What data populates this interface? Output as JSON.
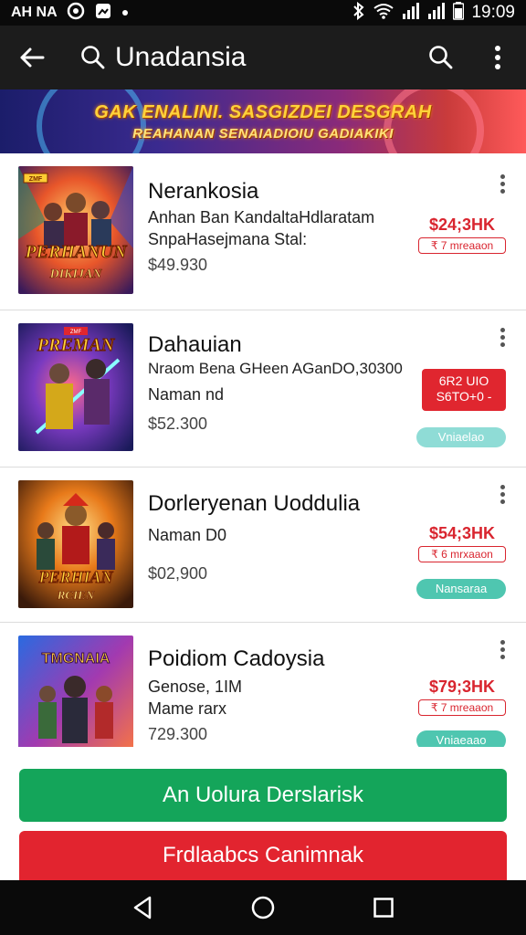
{
  "status_bar": {
    "carrier": "AH NA",
    "time": "19:09"
  },
  "app_bar": {
    "title": "Unadansia"
  },
  "banner": {
    "line1": "GAK ENALINI. SASGIZDEI DESGRAH",
    "line2": "REAHANAN SENAIADIOIU GADIAKIKI"
  },
  "items": [
    {
      "title": "Nerankosia",
      "line1": "Anhan Ban KandaltaHdlaratam",
      "line2": "SnpaHasejmana Stal:",
      "price": "$49.930",
      "side_price": "$24;3HK",
      "side_tag": "₹ 7 mreaaon",
      "thumb_text1": "PERHANUN",
      "thumb_text2": "DIKIJAN",
      "thumb_badge": "ZMF"
    },
    {
      "title": "Dahauian",
      "line1": "Nraom Bena GHeen AGanDO,30300",
      "line2": "Naman nd",
      "price": "$52.300",
      "side_button_line1": "6R2 UIO",
      "side_button_line2": "S6TO+0 -",
      "pill": "Vniaelao",
      "thumb_text1": "PREMAN",
      "thumb_badge": "ZMF"
    },
    {
      "title": "Dorleryenan Uoddulia",
      "line1": "Naman D0",
      "price": "$02,900",
      "side_price": "$54;3HK",
      "side_tag": "₹ 6 mrxaaon",
      "pill": "Nansaraa",
      "thumb_text1": "PERHIAN",
      "thumb_text2": "RCIEN"
    },
    {
      "title": "Poidiom Cadoysia",
      "line1": "Genose, 1IM",
      "line2": "Mame rarx",
      "price": "729.300",
      "side_price": "$79;3HK",
      "side_tag": "₹ 7 mreaaon",
      "pill": "Vniaeaao",
      "thumb_text1": "TMGNAIA"
    }
  ],
  "buttons": {
    "green": "An Uolura Derslarisk",
    "red": "Frdlaabcs Canimnak"
  },
  "colors": {
    "app_bar": "#1c1c1c",
    "accent_red": "#d9252f",
    "accent_green": "#14a55a",
    "pill_teal": "#4fc6b0"
  }
}
